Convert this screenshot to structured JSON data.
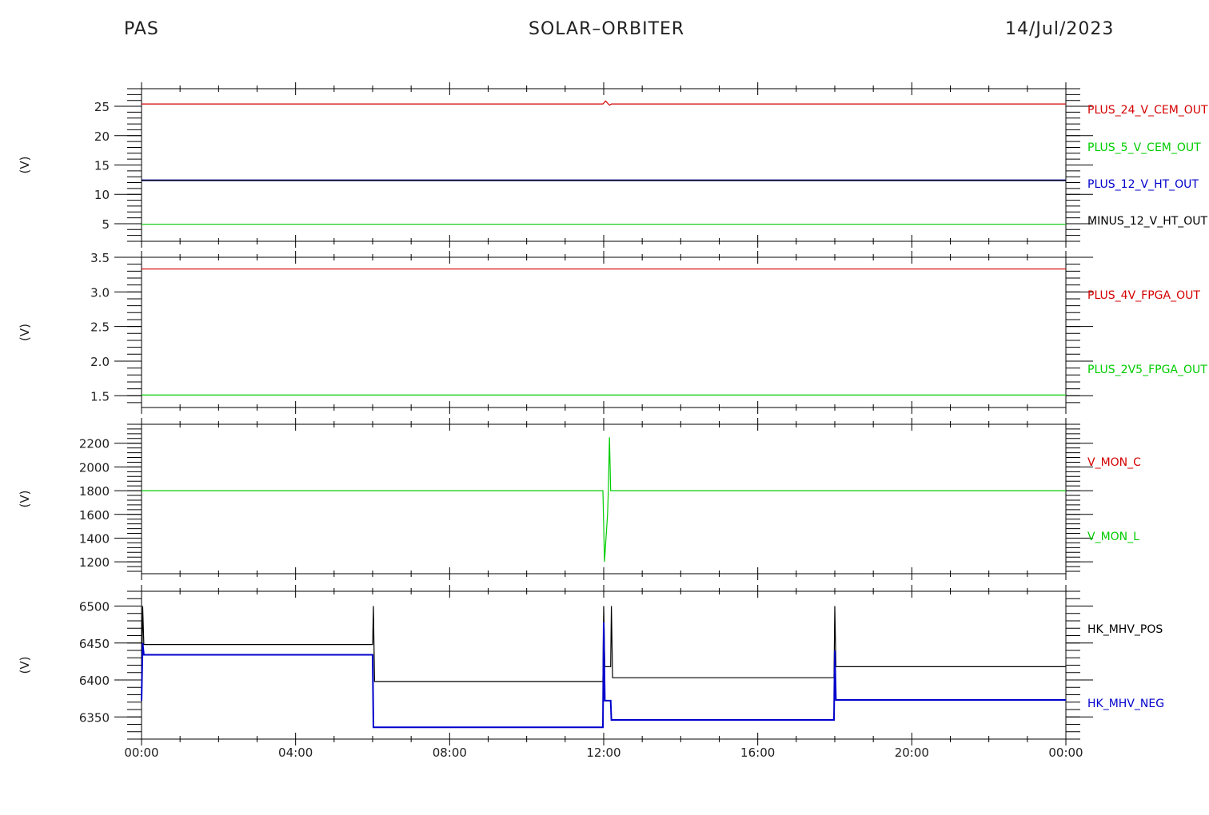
{
  "header": {
    "left": "PAS",
    "center": "SOLAR–ORBITER",
    "right": "14/Jul/2023"
  },
  "colors": {
    "red": "#d40000",
    "green": "#00cc00",
    "blue": "#0000cc",
    "black": "#000000",
    "axis": "#000000"
  },
  "x_axis": {
    "range": [
      0,
      24
    ],
    "ticks": [
      0,
      4,
      8,
      12,
      16,
      20,
      24
    ],
    "tick_labels": [
      "00:00",
      "04:00",
      "08:00",
      "12:00",
      "16:00",
      "20:00",
      "00:00"
    ]
  },
  "chart_data": [
    {
      "type": "line",
      "ylabel": "(V)",
      "ylim": [
        2,
        28
      ],
      "yticks": [
        5,
        10,
        15,
        20,
        25
      ],
      "series": [
        {
          "name": "PLUS_24_V_CEM_OUT",
          "color": "red",
          "segments": [
            [
              [
                0,
                25.4
              ],
              [
                11.98,
                25.4
              ],
              [
                12.05,
                25.9
              ],
              [
                12.15,
                25.2
              ],
              [
                12.2,
                25.4
              ],
              [
                24,
                25.4
              ]
            ]
          ]
        },
        {
          "name": "PLUS_5_V_CEM_OUT",
          "color": "green",
          "segments": [
            [
              [
                0,
                4.9
              ],
              [
                24,
                4.9
              ]
            ]
          ]
        },
        {
          "name": "PLUS_12_V_HT_OUT",
          "color": "blue",
          "segments": [
            [
              [
                0,
                12.4
              ],
              [
                24,
                12.4
              ]
            ]
          ]
        },
        {
          "name": "MINUS_12_V_HT_OUT",
          "color": "black",
          "segments": [
            [
              [
                0,
                12.4
              ],
              [
                24,
                12.4
              ]
            ]
          ]
        }
      ]
    },
    {
      "type": "line",
      "ylabel": "(V)",
      "ylim": [
        1.33,
        3.5
      ],
      "yticks": [
        1.5,
        2.0,
        2.5,
        3.0,
        3.5
      ],
      "series": [
        {
          "name": "PLUS_4V_FPGA_OUT",
          "color": "red",
          "segments": [
            [
              [
                0,
                3.33
              ],
              [
                24,
                3.33
              ]
            ]
          ]
        },
        {
          "name": "PLUS_2V5_FPGA_OUT",
          "color": "green",
          "segments": [
            [
              [
                0,
                1.51
              ],
              [
                24,
                1.51
              ]
            ]
          ]
        }
      ]
    },
    {
      "type": "line",
      "ylabel": "(V)",
      "ylim": [
        1100,
        2360
      ],
      "yticks": [
        1200,
        1400,
        1600,
        1800,
        2000,
        2200
      ],
      "series": [
        {
          "name": "V_MON_C",
          "color": "red",
          "segments": []
        },
        {
          "name": "V_MON_L",
          "color": "green",
          "segments": [
            [
              [
                0,
                1800
              ],
              [
                11.98,
                1800
              ],
              [
                12.02,
                1200
              ],
              [
                12.1,
                1600
              ],
              [
                12.12,
                1800
              ],
              [
                12.15,
                2250
              ],
              [
                12.18,
                1800
              ],
              [
                24,
                1800
              ]
            ]
          ]
        }
      ]
    },
    {
      "type": "line",
      "ylabel": "(V)",
      "ylim": [
        6320,
        6520
      ],
      "yticks": [
        6350,
        6400,
        6450,
        6500
      ],
      "series": [
        {
          "name": "HK_MHV_POS",
          "color": "black",
          "segments": [
            [
              [
                0,
                6372
              ],
              [
                0.03,
                6500
              ],
              [
                0.06,
                6448
              ],
              [
                6.0,
                6448
              ],
              [
                6.02,
                6500
              ],
              [
                6.05,
                6398
              ],
              [
                11.98,
                6398
              ],
              [
                12.0,
                6500
              ],
              [
                12.03,
                6418
              ],
              [
                12.18,
                6418
              ],
              [
                12.2,
                6500
              ],
              [
                12.23,
                6403
              ],
              [
                17.98,
                6403
              ],
              [
                18.0,
                6500
              ],
              [
                18.03,
                6418
              ],
              [
                24,
                6418
              ]
            ]
          ]
        },
        {
          "name": "HK_MHV_NEG",
          "color": "blue",
          "segments": [
            [
              [
                0,
                6372
              ],
              [
                0.03,
                6450
              ],
              [
                0.06,
                6434
              ],
              [
                6.0,
                6434
              ],
              [
                6.02,
                6336
              ],
              [
                11.98,
                6336
              ],
              [
                12.0,
                6478
              ],
              [
                12.03,
                6372
              ],
              [
                12.18,
                6372
              ],
              [
                12.2,
                6346
              ],
              [
                17.98,
                6346
              ],
              [
                18.0,
                6440
              ],
              [
                18.03,
                6373
              ],
              [
                24,
                6373
              ]
            ]
          ]
        }
      ]
    }
  ]
}
